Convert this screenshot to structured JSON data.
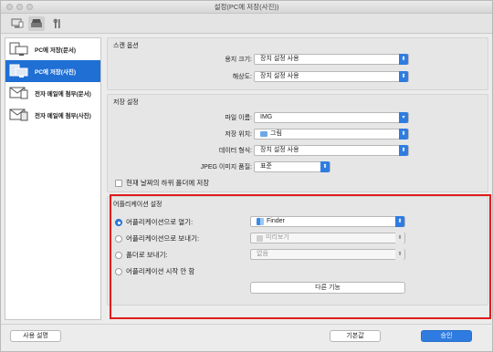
{
  "window": {
    "title": "설정(PC에 저장(사진))"
  },
  "sidebar": {
    "items": [
      {
        "label": "PC에 저장(문서)",
        "icon": "pc-save-document-icon"
      },
      {
        "label": "PC에 저장(사진)",
        "icon": "pc-save-photo-icon"
      },
      {
        "label": "전자 메일에 첨부(문서)",
        "icon": "email-attach-document-icon"
      },
      {
        "label": "전자 메일에 첨부(사진)",
        "icon": "email-attach-photo-icon"
      }
    ]
  },
  "scan": {
    "title": "스캔 옵션",
    "paper_size_label": "용지 크기:",
    "paper_size_value": "장치 설정 사용",
    "resolution_label": "해상도:",
    "resolution_value": "장치 설정 사용"
  },
  "save": {
    "title": "저장 설정",
    "filename_label": "파일 이름:",
    "filename_value": "IMG",
    "location_label": "저장 위치:",
    "location_value": "그림",
    "format_label": "데이터 형식:",
    "format_value": "장치 설정 사용",
    "jpeg_label": "JPEG 이미지 품질:",
    "jpeg_value": "표준",
    "subfolder_label": "현재 날짜의 하위 폴더에 저장"
  },
  "app": {
    "title": "어플리케이션 설정",
    "open_label": "어플리케이션으로 열기:",
    "open_value": "Finder",
    "send_label": "어플리케이션으로 보내기:",
    "send_value": "미리보기",
    "folder_label": "폴더로 보내기:",
    "folder_value": "없음",
    "none_label": "어플리케이션 시작 안 함",
    "more_button": "다른 기능"
  },
  "footer": {
    "instructions": "사용 설명",
    "defaults": "기본값",
    "ok": "승인"
  },
  "colors": {
    "accent": "#2e7ce0",
    "highlight": "#e11b1b",
    "selected": "#1f6fd4"
  }
}
